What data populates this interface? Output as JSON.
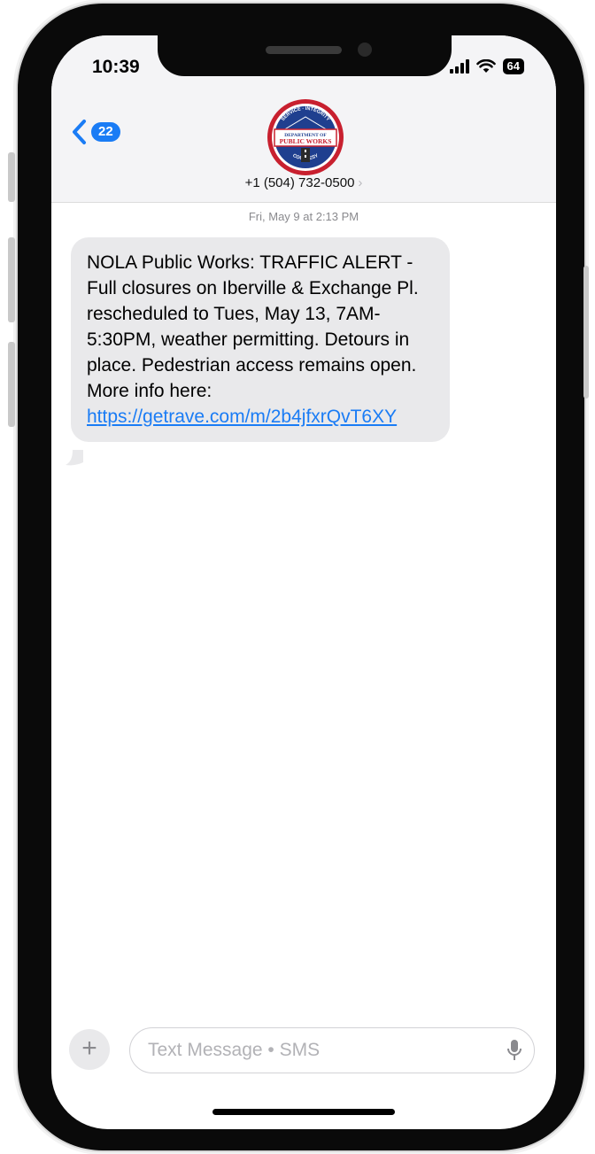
{
  "status_bar": {
    "time": "10:39",
    "battery": "64"
  },
  "header": {
    "back_count": "22",
    "avatar_text": {
      "top": "SERVICE · INTEGRITY",
      "middle_1": "DEPARTMENT OF",
      "middle_2": "PUBLIC WORKS",
      "bottom": "COURTESY"
    },
    "contact": "+1 (504) 732-0500"
  },
  "conversation": {
    "timestamp": "Fri, May 9 at 2:13 PM",
    "message_text": "NOLA Public Works: TRAFFIC ALERT - Full closures on Iberville & Exchange Pl. rescheduled to Tues, May 13, 7AM-5:30PM, weather permitting. Detours in place. Pedestrian access remains open. More info here: ",
    "message_link": "https://getrave.com/m/2b4jfxrQvT6XY"
  },
  "composer": {
    "placeholder": "Text Message • SMS"
  },
  "colors": {
    "accent": "#1a7cf5",
    "bubble": "#e9e9eb",
    "header_bg": "#f4f4f6"
  },
  "icons": [
    "back-chevron-icon",
    "signal-icon",
    "wifi-icon",
    "battery-icon",
    "plus-icon",
    "microphone-icon"
  ]
}
